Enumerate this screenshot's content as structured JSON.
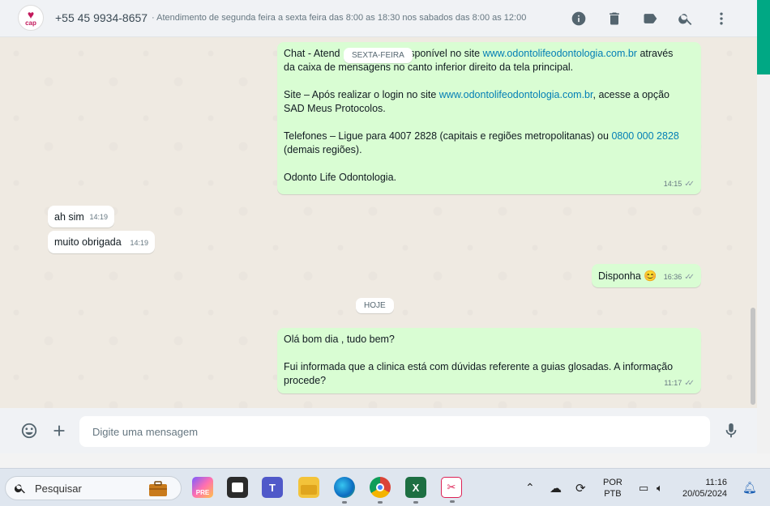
{
  "header": {
    "avatar_text": "cap",
    "contact_name": "+55 45 9934-8657",
    "status": "· Atendimento de segunda feira a sexta feira das 8:00 as 18:30 nos sabados das 8:00 as 12:00"
  },
  "chat": {
    "chips": {
      "sexta": "SEXTA-FEIRA",
      "hoje": "HOJE"
    },
    "msg1": {
      "l1a": "Chat - Atend",
      "l1b": "disponível no site ",
      "l1_link": "www.odontolifeodontologia.com.br",
      "l1c": " através",
      "l2": "da caixa de mensagens no canto inferior direito da tela principal.",
      "l3a": "Site – Após realizar o login no site ",
      "l3_link": "www.odontolifeodontologia.com.br",
      "l3b": ", acesse a opção",
      "l4": "SAD Meus Protocolos.",
      "l5a": "Telefones – Ligue para 4007 2828 (capitais e regiões metropolitanas) ou ",
      "l5_link": "0800 000 2828",
      "l6": "(demais regiões).",
      "l7": "Odonto Life Odontologia.",
      "time": "14:15"
    },
    "msg2": {
      "text": "ah sim",
      "time": "14:19"
    },
    "msg3": {
      "text": "muito obrigada",
      "time": "14:19"
    },
    "msg4": {
      "text": "Disponha",
      "emoji": "😊",
      "time": "16:36"
    },
    "msg5": {
      "l1": "Olá bom dia , tudo bem?",
      "l2": "Fui informada que a clinica está com dúvidas referente a guias glosadas. A informação",
      "l3": "procede?",
      "time": "11:17"
    }
  },
  "composer": {
    "placeholder": "Digite uma mensagem"
  },
  "taskbar": {
    "search_label": "Pesquisar",
    "lang_1": "POR",
    "lang_2": "PTB",
    "time": "11:16",
    "date": "20/05/2024"
  }
}
